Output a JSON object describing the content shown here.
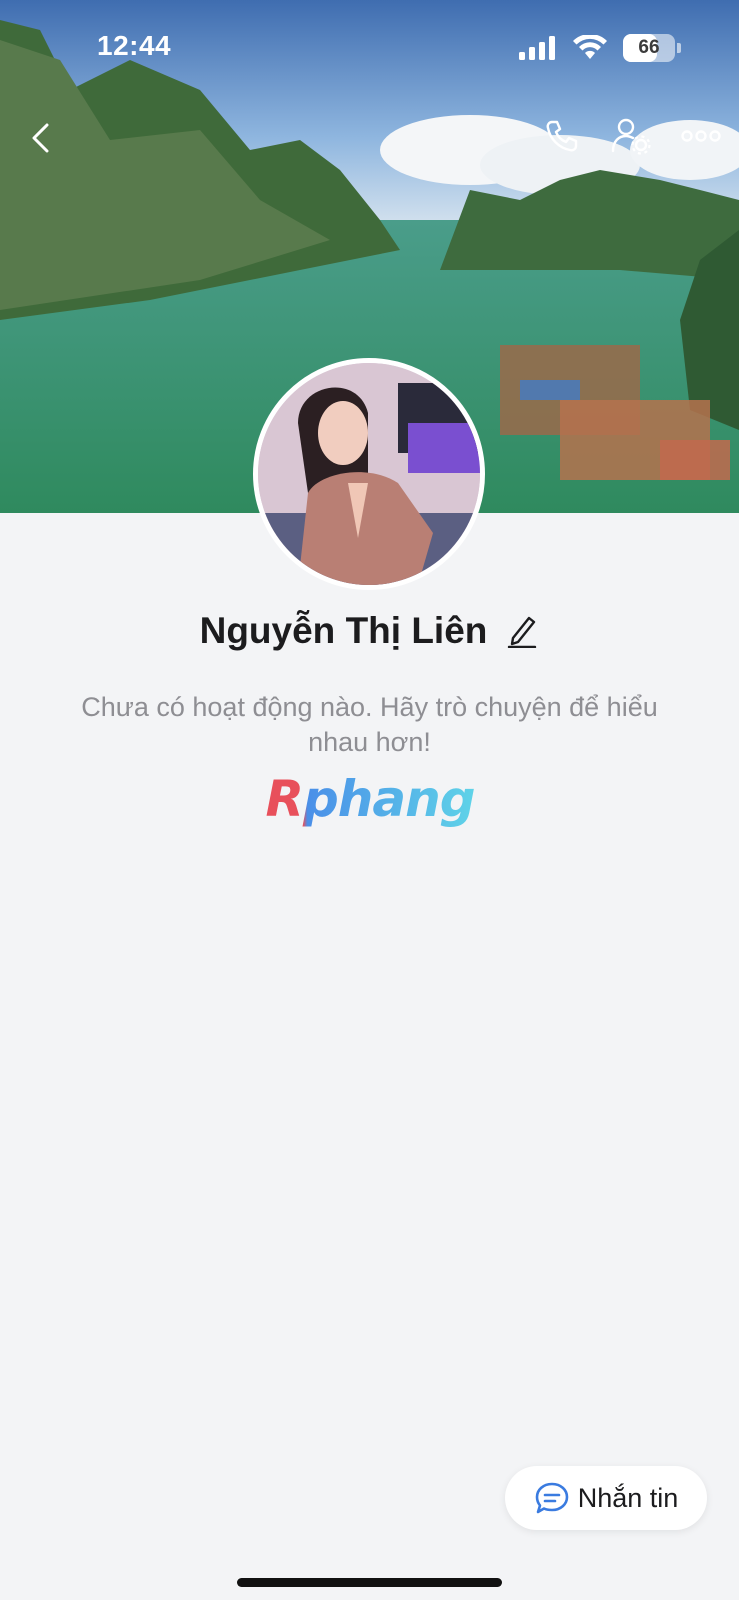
{
  "status_bar": {
    "time": "12:44",
    "battery_level": "66",
    "battery_fraction": 0.66
  },
  "header": {
    "back_icon": "chevron-left-icon",
    "actions": [
      "phone-icon",
      "user-settings-icon",
      "more-icon"
    ]
  },
  "profile": {
    "name": "Nguyễn Thị Liên",
    "activity_text": "Chưa có hoạt động nào. Hãy trò chuyện để hiểu nhau hơn!",
    "logo_text": "Rphang"
  },
  "actions": {
    "message_label": "Nhắn tin",
    "message_icon": "chat-bubble-icon"
  },
  "colors": {
    "accent": "#3a7be0",
    "background": "#f3f4f6",
    "logo_red": "#e8505b",
    "logo_blue": "#4a8fe8",
    "logo_cyan": "#5fd3e8"
  }
}
